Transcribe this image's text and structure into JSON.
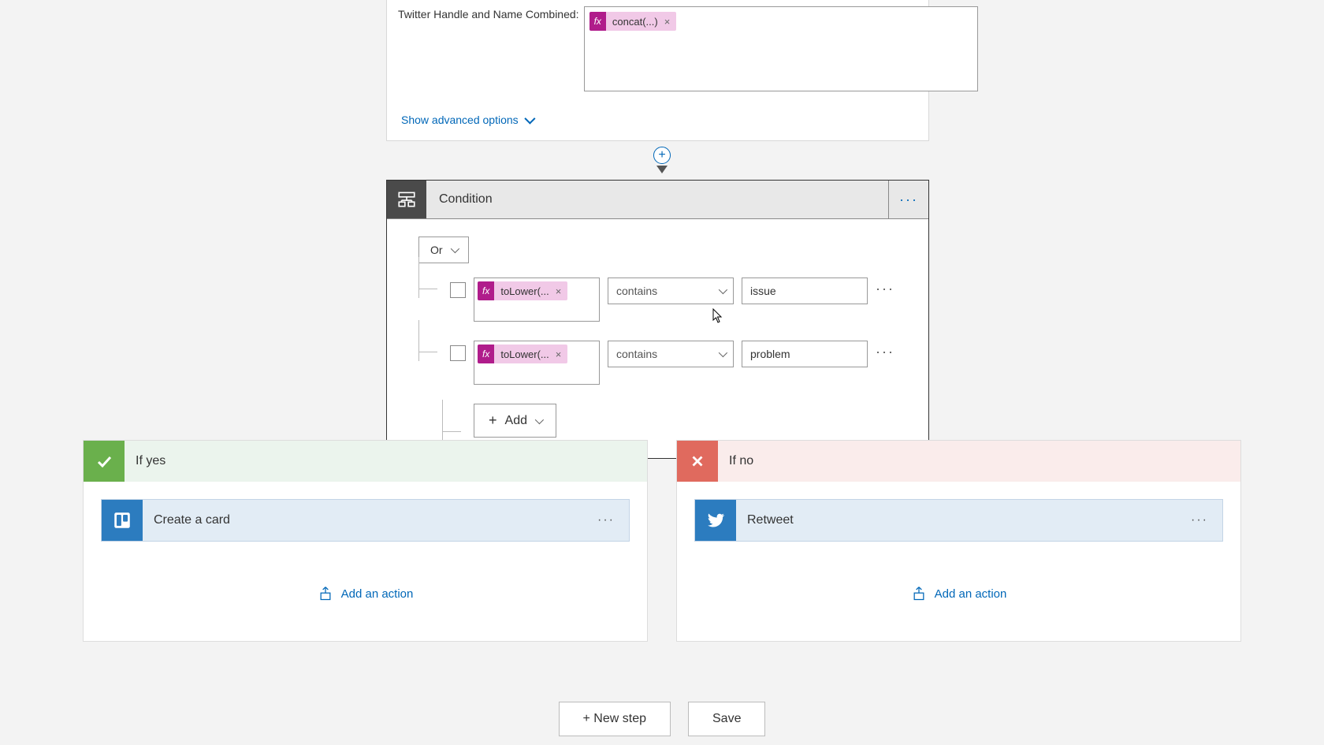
{
  "topCard": {
    "fieldLabel": "Twitter Handle and Name Combined:",
    "token": "concat(...)",
    "showAdvanced": "Show advanced options"
  },
  "condition": {
    "title": "Condition",
    "logicOp": "Or",
    "rows": [
      {
        "expr": "toLower(...",
        "operator": "contains",
        "compare": "issue"
      },
      {
        "expr": "toLower(...",
        "operator": "contains",
        "compare": "problem"
      }
    ],
    "addLabel": "Add"
  },
  "branches": {
    "yes": {
      "title": "If yes",
      "action": "Create a card",
      "addAction": "Add an action"
    },
    "no": {
      "title": "If no",
      "action": "Retweet",
      "addAction": "Add an action"
    }
  },
  "footer": {
    "newStep": "+ New step",
    "save": "Save"
  }
}
